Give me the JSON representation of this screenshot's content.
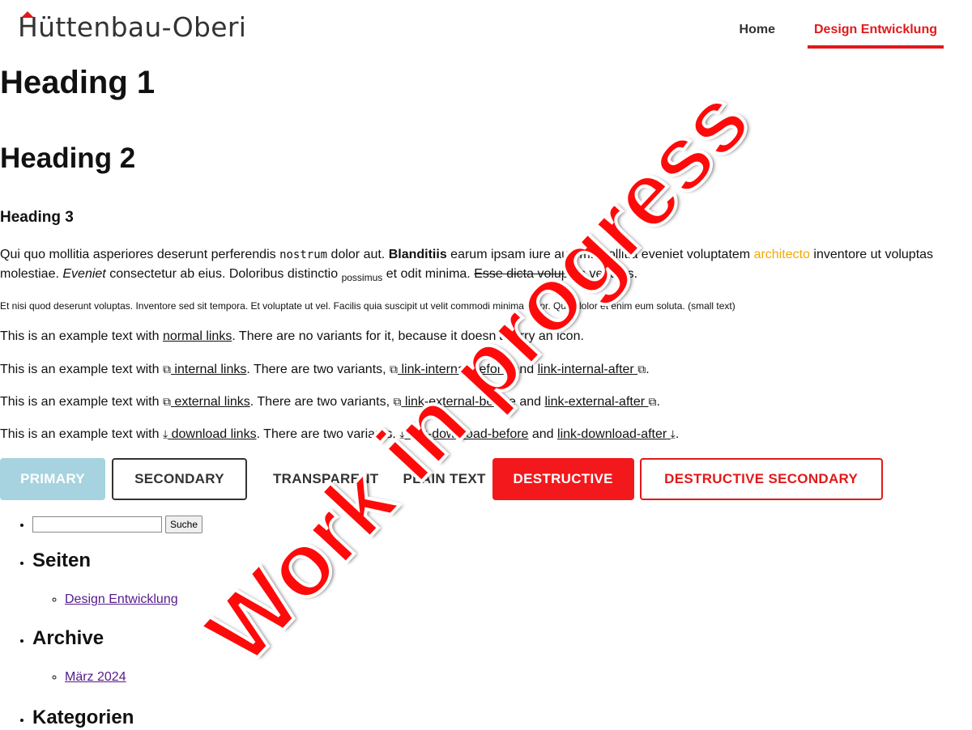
{
  "header": {
    "logo_text": "Hüttenbau-Oberi",
    "nav": [
      {
        "label": "Home",
        "active": false
      },
      {
        "label": "Design Entwicklung",
        "active": true
      }
    ]
  },
  "headings": {
    "h1": "Heading 1",
    "h2": "Heading 2",
    "h3": "Heading 3"
  },
  "paragraph": {
    "t1": "Qui quo mollitia asperiores deserunt perferendis ",
    "code": "nostrum",
    "t2": " dolor aut. ",
    "bold": "Blanditiis",
    "t3": " earum ipsam iure autem. Mollitia eveniet voluptatem ",
    "accent": "architecto",
    "t4": " inventore ut voluptas molestiae. ",
    "italic": "Eveniet",
    "t5": " consectetur ab eius. Doloribus distinctio ",
    "sub": "possimus",
    "t6": " et odit minima. ",
    "strike": "Esse dicta voluptas",
    "t7": " veritatis."
  },
  "small_text": "Et nisi quod deserunt voluptas. Inventore sed sit tempora. Et voluptate ut vel. Facilis quia suscipit ut velit commodi minima dolor. Quis dolor et enim eum soluta. (small text)",
  "links": {
    "normal": {
      "pre": "This is an example text with ",
      "link": "normal links",
      "post": ". There are no variants for it, because it doesn’t carry an icon."
    },
    "internal": {
      "pre": "This is an example text with ",
      "link": "internal links",
      "mid": ". There are two variants, ",
      "v1": "link-internal-before",
      "and": " and ",
      "v2": "link-internal-after",
      "end": "."
    },
    "external": {
      "pre": "This is an example text with ",
      "link": "external links",
      "mid": ". There are two variants, ",
      "v1": "link-external-before",
      "and": " and ",
      "v2": "link-external-after",
      "end": "."
    },
    "download": {
      "pre": "This is an example text with ",
      "link": "download links",
      "mid": ". There are two variants, ",
      "v1": "link-download-before",
      "and": " and ",
      "v2": "link-download-after",
      "end": "."
    }
  },
  "buttons": {
    "primary": "PRIMARY",
    "secondary": "SECONDARY",
    "transparent": "TRANSPARENT",
    "plain": "PLAIN TEXT",
    "destructive": "DESTRUCTIVE",
    "destructive_secondary": "DESTRUCTIVE SECONDARY"
  },
  "sidebar": {
    "search_value": "",
    "search_button": "Suche",
    "pages_title": "Seiten",
    "pages_items": [
      "Design Entwicklung"
    ],
    "archive_title": "Archive",
    "archive_items": [
      "März 2024"
    ],
    "categories_title": "Kategorien"
  },
  "watermark": "Work in progress",
  "colors": {
    "brand_red": "#e1191a",
    "accent_yellow": "#f5a800",
    "primary_button": "#a6d3df"
  },
  "icons": {
    "internal": "external-link-square-icon",
    "external": "external-link-square-icon",
    "download": "download-arrow-icon"
  }
}
